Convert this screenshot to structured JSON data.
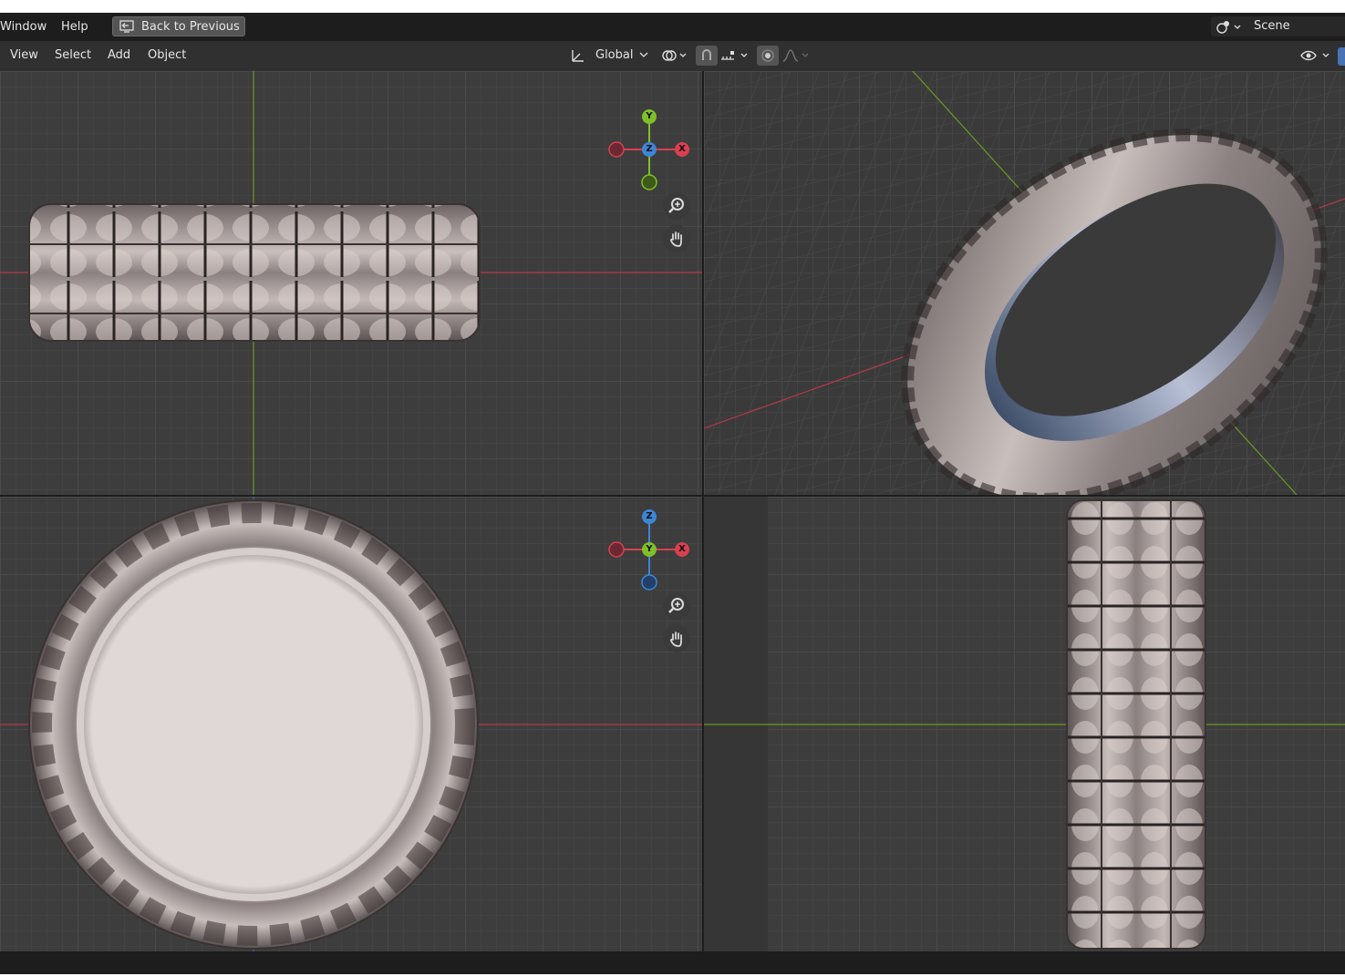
{
  "topbar": {
    "menus": [
      "Window",
      "Help"
    ],
    "back_button": "Back to Previous",
    "scene": "Scene"
  },
  "header": {
    "menus": [
      "View",
      "Select",
      "Add",
      "Object"
    ],
    "transform_orientation": "Global"
  },
  "viewports": {
    "top_left": {
      "gizmo": {
        "up": "Y",
        "center": "Z",
        "right": "X"
      }
    },
    "bottom_left": {
      "gizmo": {
        "up": "Z",
        "center": "Y",
        "right": "X"
      }
    }
  },
  "colors": {
    "axis_x": "#d84052",
    "axis_y": "#7fbf2a",
    "axis_z": "#3d86d6",
    "grid_bg": "#3d3d3d",
    "ui_dark": "#1d1d1d",
    "header": "#303030"
  },
  "icons": [
    "back-icon",
    "editor-type-icon",
    "orientation-icon",
    "pivot-icon",
    "snap-icon",
    "proportional-icon",
    "visibility-icon",
    "zoom-icon",
    "pan-hand-icon"
  ]
}
